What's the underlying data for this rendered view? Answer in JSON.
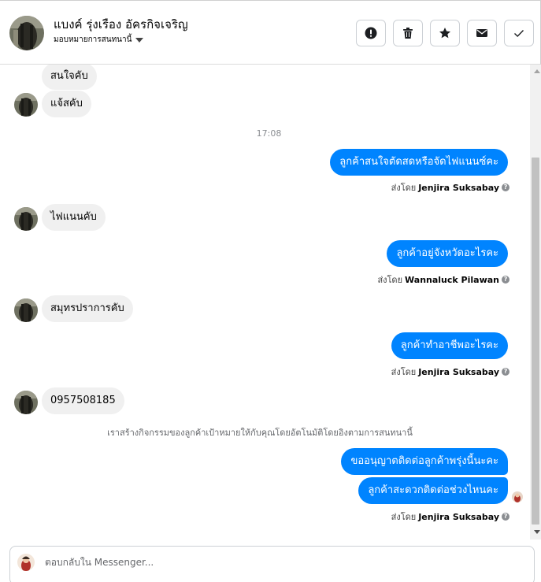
{
  "header": {
    "contact_name": "แบงค์ รุ่งเรือง อัครกิจเจริญ",
    "assign_label": "มอบหมายการสนทนานี้",
    "actions": [
      {
        "icon": "alert-icon",
        "label": "Mark as spam"
      },
      {
        "icon": "trash-icon",
        "label": "Delete"
      },
      {
        "icon": "star-icon",
        "label": "Star"
      },
      {
        "icon": "envelope-icon",
        "label": "Mark as unread"
      },
      {
        "icon": "check-icon",
        "label": "Mark as done"
      }
    ]
  },
  "messages": {
    "in_1": "สนใจคับ",
    "in_2": "แจ้สคับ",
    "timestamp": "17:08",
    "out_1": "ลูกค้าสนใจตัดสดหรือจัดไฟแนนซ์คะ",
    "sent_by_1_prefix": "ส่งโดย",
    "sent_by_1_name": "Jenjira Suksabay",
    "in_3": "ไฟแนนคับ",
    "out_2": "ลูกค้าอยู่จังหวัดอะไรคะ",
    "sent_by_2_prefix": "ส่งโดย",
    "sent_by_2_name": "Wannaluck Pilawan",
    "in_4": "สมุทรปราการคับ",
    "out_3": "ลูกค้าทำอาชีพอะไรคะ",
    "sent_by_3_prefix": "ส่งโดย",
    "sent_by_3_name": "Jenjira Suksabay",
    "in_5": "0957508185",
    "system_note": "เราสร้างกิจกรรมของลูกค้าเป้าหมายให้กับคุณโดยอัตโนมัติโดยอิงตามการสนทนานี้",
    "out_4": "ขออนุญาตติดต่อลูกค้าพรุ่งนี้นะคะ",
    "out_5": "ลูกค้าสะดวกติดต่อช่วงไหนคะ",
    "sent_by_4_prefix": "ส่งโดย",
    "sent_by_4_name": "Jenjira Suksabay",
    "help_glyph": "?"
  },
  "composer": {
    "placeholder": "ตอบกลับใน Messenger..."
  },
  "colors": {
    "outgoing_bubble": "#0084ff",
    "incoming_bubble": "#f0f0f0",
    "border": "#ccd0d5"
  }
}
